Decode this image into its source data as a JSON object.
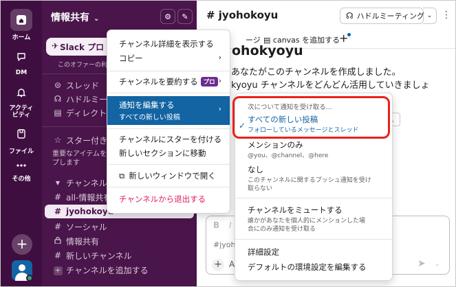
{
  "rail": {
    "home": "ホーム",
    "dm": "DM",
    "activity_line1": "アクティ",
    "activity_line2": "ビティ",
    "files": "ファイル",
    "more": "その他"
  },
  "sidebar": {
    "workspace_name": "情報共有",
    "promo_button": "Slack プロ",
    "promo_text": "このオファーの利",
    "items": [
      {
        "label": "スレッド"
      },
      {
        "label": "ハドルミー"
      },
      {
        "label": "ディレクトリ"
      }
    ],
    "starred_section": "スター付き",
    "starred_desc_line1": "重要なアイテムを",
    "starred_desc_line2": "プします",
    "channels_section": "チャンネル",
    "channels": [
      {
        "name": "all-情報共有",
        "prefix": "#"
      },
      {
        "name": "jyohokoyu",
        "prefix": "#",
        "active": true
      },
      {
        "name": "ソーシャル",
        "prefix": "#"
      },
      {
        "name": "情報共有",
        "prefix": "lock"
      },
      {
        "name": "新しいチャンネル",
        "prefix": "#"
      }
    ],
    "add_channel": "チャンネルを追加する"
  },
  "main": {
    "channel_title": "# jyohokoyu",
    "huddle_button": "ハドルミーティング",
    "tabs": {
      "message_tab": "ージ",
      "canvas_tab": "canvas を追加する"
    },
    "intro_name": "ohokyoyu",
    "intro_line1": "あなたがこのチャンネルを作成しました。",
    "intro_line2": "kyoyu チャンネルをどんどん活用していきましょ",
    "small_button": "る",
    "composer_placeholder": "#jyoh",
    "composer_format_b": "B",
    "composer_format_i": "I",
    "composer_a": "A"
  },
  "context_menu": {
    "show_details": "チャンネル詳細を表示する",
    "copy": "コピー",
    "summarize": "チャンネルを要約する",
    "pro_badge": "プロ",
    "edit_notifications": "通知を編集する",
    "all_new_posts": "すべての新しい投稿",
    "star_channel": "チャンネルにスターを付ける",
    "move_to_section": "新しいセクションに移動",
    "open_new_window": "新しいウィンドウで開く",
    "leave_channel": "チャンネルから退出する"
  },
  "notify_submenu": {
    "header": "次について通知を受け取る...",
    "all_posts": "すべての新しい投稿",
    "all_posts_desc": "フォローしているメッセージとスレッド",
    "mentions_only": "メンションのみ",
    "mentions_desc": "@you、@channel、@here",
    "none": "なし",
    "none_desc_line1": "このチャンネルに関するプッシュ通知を受け",
    "none_desc_line2": "取らない",
    "mute": "チャンネルをミュートする",
    "mute_desc_line1": "誰かがあなたを個人的にメンションした場",
    "mute_desc_line2": "合にのみ通知を受け取る",
    "details": "詳細設定",
    "edit_defaults": "デフォルトの環境設定を編集する"
  },
  "colors": {
    "rail_bg": "#3f0e40",
    "sidebar_bg": "#4a154b",
    "highlight": "#1264a3",
    "danger": "#e01e5a",
    "annotation": "#e8211c"
  }
}
